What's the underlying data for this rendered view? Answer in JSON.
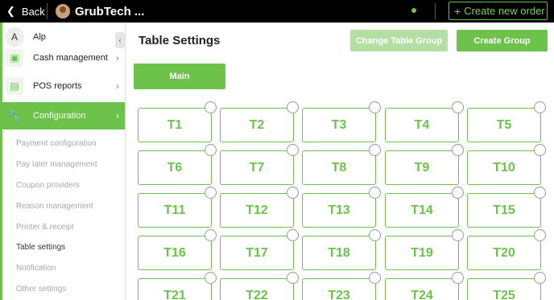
{
  "topbar": {
    "back_label": "Back",
    "app_name": "GrubTech ...",
    "create_order_label": "Create new order",
    "accent": "#6cc24a"
  },
  "sidebar": {
    "user_initial": "A",
    "user_name": "Alp",
    "collapse_icon": "chevron-left-icon",
    "menu": [
      {
        "label": "Cash management",
        "icon": "cash-register-icon"
      },
      {
        "label": "POS reports",
        "icon": "report-icon"
      },
      {
        "label": "Configuration",
        "icon": "wrench-icon",
        "active": true
      }
    ],
    "submenu": [
      "Payment configuration",
      "Pay later management",
      "Coupon providers",
      "Reason management",
      "Printer & receipt",
      "Table settings",
      "Notification",
      "Other settings"
    ],
    "selected_submenu": "Table settings"
  },
  "main": {
    "title": "Table Settings",
    "change_group_label": "Change Table Group",
    "create_group_label": "Create Group",
    "group_tab": "Main",
    "tables": [
      "T1",
      "T2",
      "T3",
      "T4",
      "T5",
      "T6",
      "T7",
      "T8",
      "T9",
      "T10",
      "T11",
      "T12",
      "T13",
      "T14",
      "T15",
      "T16",
      "T17",
      "T18",
      "T19",
      "T20",
      "T21",
      "T22",
      "T23",
      "T24",
      "T25"
    ]
  }
}
